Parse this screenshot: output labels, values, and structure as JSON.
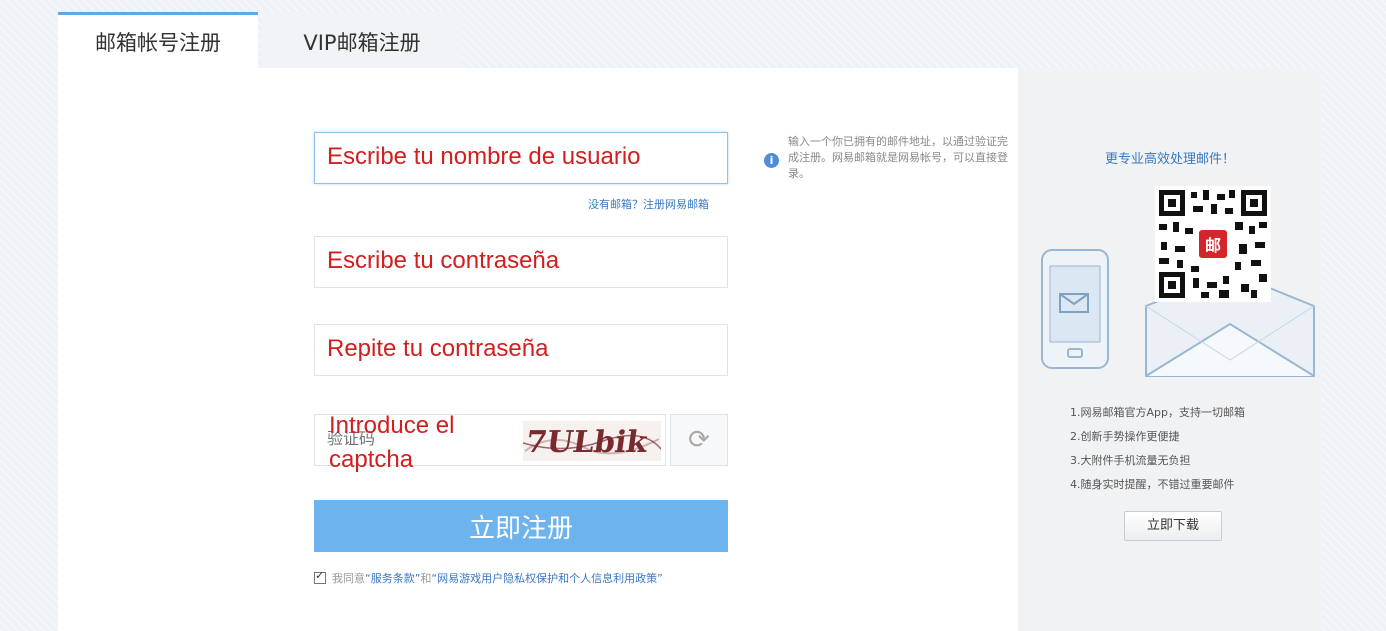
{
  "tabs": [
    {
      "label": "邮箱帐号注册"
    },
    {
      "label": "VIP邮箱注册"
    }
  ],
  "form": {
    "username": {
      "overlay": "Escribe tu nombre de usuario",
      "hint_link": "没有邮箱？注册网易邮箱"
    },
    "password": {
      "overlay": "Escribe tu contraseña"
    },
    "confirm": {
      "overlay": "Repite tu contraseña"
    },
    "captcha": {
      "placeholder": "验证码",
      "overlay_line1": "Introduce el",
      "overlay_line2": "captcha",
      "image_text": "7ULbik"
    },
    "refresh_icon": "refresh-icon",
    "submit_label": "立即注册",
    "agreement": {
      "prefix": "我同意",
      "terms": "“服务条款”",
      "and": "和",
      "policy": "“网易游戏用户隐私权保护和个人信息利用政策”"
    }
  },
  "info": {
    "icon": "info-icon",
    "text": "输入一个你已拥有的邮件地址，以通过验证完成注册。网易邮箱就是网易帐号，可以直接登录。"
  },
  "sidebar": {
    "title": "更专业高效处理邮件！",
    "qr_badge": "邮",
    "features": [
      "1.网易邮箱官方App，支持一切邮箱",
      "2.创新手势操作更便捷",
      "3.大附件手机流量无负担",
      "4.随身实时提醒，不错过重要邮件"
    ],
    "download_label": "立即下载"
  },
  "colors": {
    "accent": "#6db3ee",
    "overlay": "#d11f1f",
    "link": "#3a78c2"
  }
}
